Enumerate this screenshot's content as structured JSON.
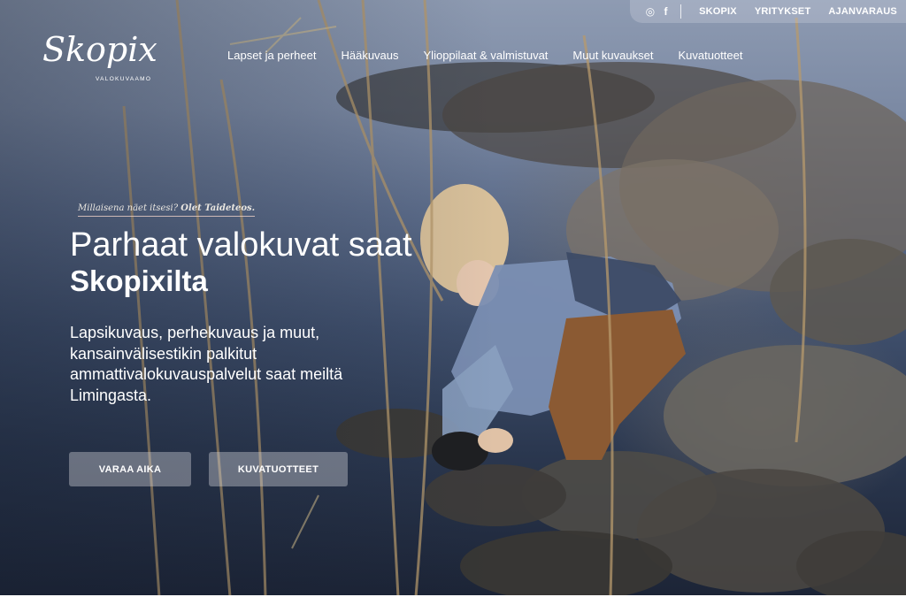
{
  "topbar": {
    "social": [
      {
        "icon": "instagram-icon",
        "glyph": "◎"
      },
      {
        "icon": "facebook-icon",
        "glyph": "f"
      }
    ],
    "links": [
      "SKOPIX",
      "YRITYKSET",
      "AJANVARAUS"
    ]
  },
  "logo": {
    "word": "Skopix",
    "sub": "VALOKUVAAMO"
  },
  "nav": {
    "items": [
      "Lapset ja perheet",
      "Hääkuvaus",
      "Ylioppilaat & valmistuvat",
      "Muut kuvaukset",
      "Kuvatuotteet"
    ]
  },
  "hero": {
    "tagline_start": "Millaisena näet itsesi? ",
    "tagline_bold": "Olet Taideteos.",
    "title_line1": "Parhaat valokuvat saat",
    "title_line2": "Skopixilta",
    "lead": "Lapsikuvaus, perhekuvaus ja muut, kansainvälisestikin palkitut ammattivalokuvauspalvelut saat meiltä Limingasta.",
    "button_book": "VARAA AIKA",
    "button_products": "KUVATUOTTEET"
  }
}
